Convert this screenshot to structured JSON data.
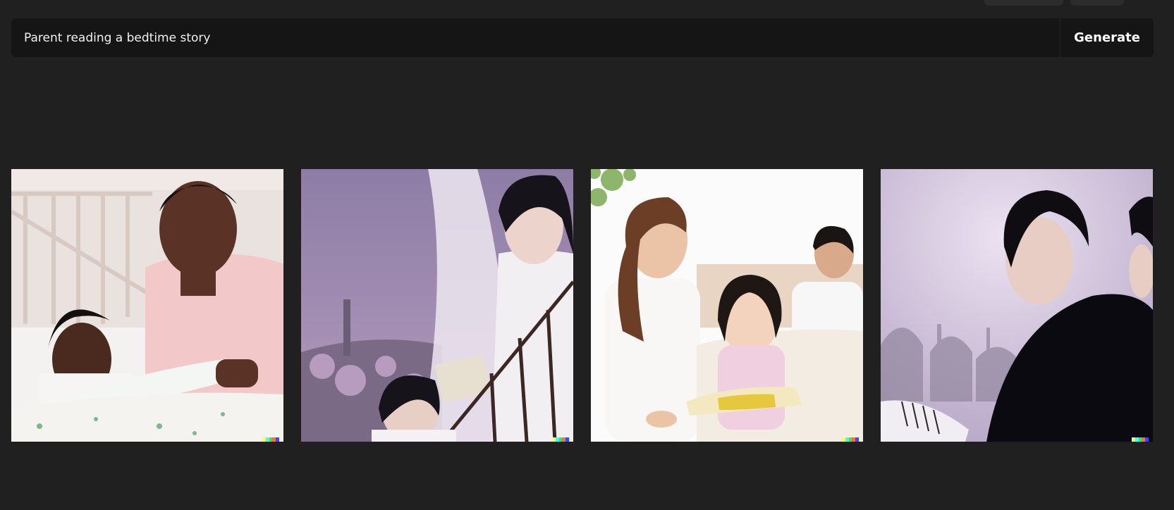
{
  "prompt": {
    "value": "Parent reading a bedtime story"
  },
  "generate_button": {
    "label": "Generate"
  },
  "results": [
    {
      "name": "result-image-1",
      "description_icon": "image"
    },
    {
      "name": "result-image-2",
      "description_icon": "image"
    },
    {
      "name": "result-image-3",
      "description_icon": "image"
    },
    {
      "name": "result-image-4",
      "description_icon": "image"
    }
  ],
  "colors": {
    "background": "#202020",
    "prompt_bar": "#151515",
    "watermark": [
      "#ffff66",
      "#42ffff",
      "#51da4c",
      "#ff6e3c",
      "#3c46ff"
    ]
  }
}
